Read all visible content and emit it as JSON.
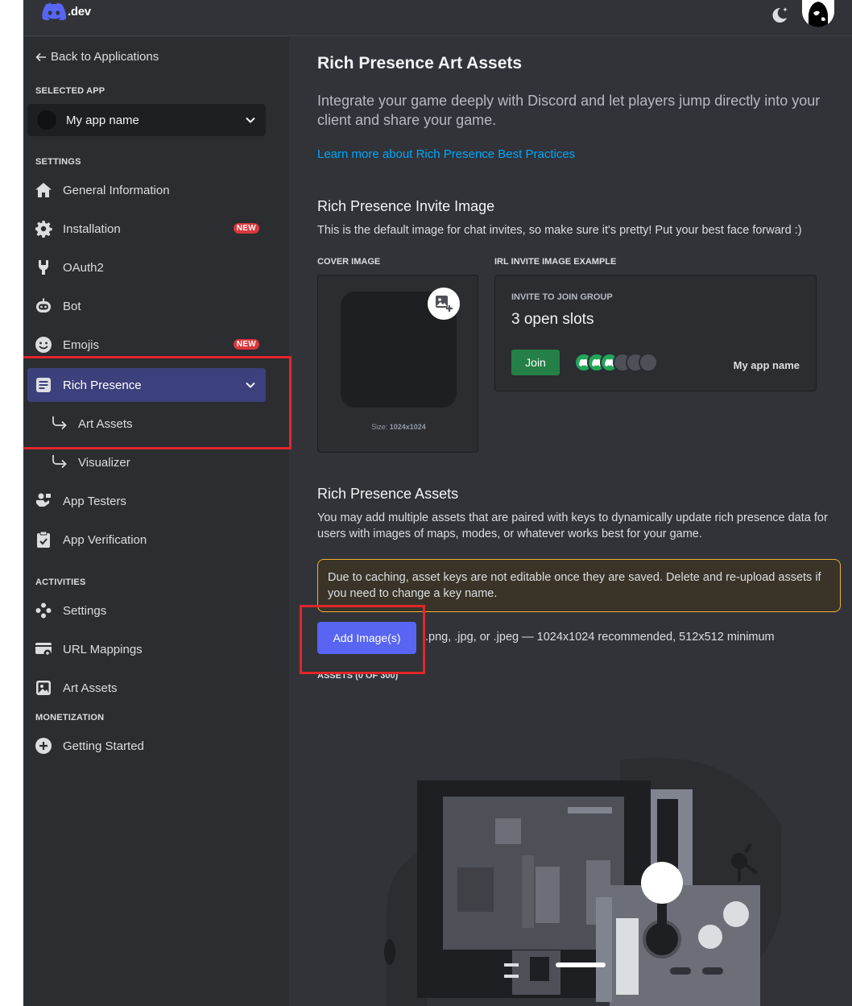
{
  "header": {
    "logo_text": ".dev",
    "theme_toggle_icon": "moon-stars-icon",
    "avatar_icon": "user-avatar"
  },
  "sidebar": {
    "back_link": "Back to Applications",
    "selected_app_label": "SELECTED APP",
    "selected_app": "My app name",
    "settings_label": "SETTINGS",
    "settings_items": [
      {
        "label": "General Information",
        "icon": "home-icon"
      },
      {
        "label": "Installation",
        "icon": "gear-icon",
        "badge": "NEW"
      },
      {
        "label": "OAuth2",
        "icon": "wrench-icon"
      },
      {
        "label": "Bot",
        "icon": "robot-icon"
      },
      {
        "label": "Emojis",
        "icon": "smile-icon",
        "badge": "NEW"
      },
      {
        "label": "Rich Presence",
        "icon": "list-icon"
      }
    ],
    "rich_presence_sub": [
      {
        "label": "Art Assets"
      },
      {
        "label": "Visualizer"
      }
    ],
    "more_items": [
      {
        "label": "App Testers",
        "icon": "user-flag-icon"
      },
      {
        "label": "App Verification",
        "icon": "clipboard-check-icon"
      }
    ],
    "activities_label": "ACTIVITIES",
    "activities_items": [
      {
        "label": "Settings",
        "icon": "gamepad-icon"
      },
      {
        "label": "URL Mappings",
        "icon": "link-card-icon"
      },
      {
        "label": "Art Assets",
        "icon": "image-icon"
      }
    ],
    "monetization_label": "MONETIZATION",
    "monetization_items": [
      {
        "label": "Getting Started",
        "icon": "plus-circle-icon"
      }
    ]
  },
  "main": {
    "title": "Rich Presence Art Assets",
    "lead": "Integrate your game deeply with Discord and let players jump directly into your client and share your game.",
    "learn_more": "Learn more about Rich Presence Best Practices",
    "invite": {
      "title": "Rich Presence Invite Image",
      "description": "This is the default image for chat invites, so make sure it's pretty! Put your best face forward :)",
      "cover_label": "COVER IMAGE",
      "cover_size_prefix": "Size: ",
      "cover_size": "1024x1024",
      "example_label": "IRL INVITE IMAGE EXAMPLE",
      "card_title": "INVITE TO JOIN GROUP",
      "card_slots": "3 open slots",
      "join_label": "Join",
      "card_app_name": "My app name"
    },
    "assets": {
      "title": "Rich Presence Assets",
      "description": "You may add multiple assets that are paired with keys to dynamically update rich presence data for users with images of maps, modes, or whatever works best for your game.",
      "warning": "Due to caching, asset keys are not editable once they are saved. Delete and re-upload assets if you need to change a key name.",
      "add_button": "Add Image(s)",
      "hint": ".png, .jpg, or .jpeg — 1024x1024 recommended, 512x512 minimum",
      "count_label": "ASSETS (0 OF 300)"
    }
  },
  "colors": {
    "accent": "#5865f2",
    "annotation": "#e0262a",
    "active_nav": "#3c417d",
    "join": "#248046",
    "link": "#00a8fc"
  }
}
